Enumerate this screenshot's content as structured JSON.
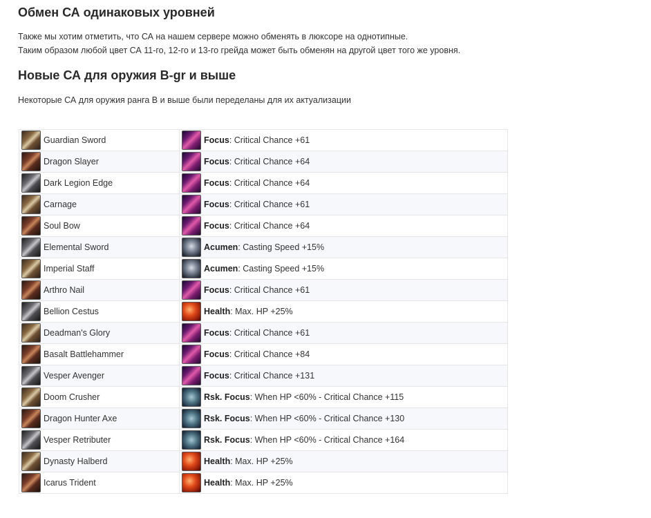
{
  "sections": [
    {
      "heading": "Обмен СА одинаковых уровней",
      "lines": [
        "Также мы хотим отметить, что СА на нашем сервере можно обменять в люксоре на однотипные.",
        "Таким образом любой цвет СА 11-го, 12-го и 13-го грейда может быть обменян на другой цвет того же уровня."
      ]
    },
    {
      "heading": "Новые СА для оружия B-gr и выше",
      "lines": [
        "Некоторые СА для оружия ранга B и выше были переделаны для их актуализации"
      ]
    }
  ],
  "table": {
    "rows": [
      {
        "weapon": "Guardian Sword",
        "weapon_icon": "sword-icon",
        "sa": "Focus",
        "effect": ": Critical Chance +61",
        "sa_icon": "focus-icon"
      },
      {
        "weapon": "Dragon Slayer",
        "weapon_icon": "sword-icon",
        "sa": "Focus",
        "effect": ": Critical Chance +64",
        "sa_icon": "focus-icon"
      },
      {
        "weapon": "Dark Legion Edge",
        "weapon_icon": "sword-icon",
        "sa": "Focus",
        "effect": ": Critical Chance +64",
        "sa_icon": "focus-icon"
      },
      {
        "weapon": "Carnage",
        "weapon_icon": "bow-icon",
        "sa": "Focus",
        "effect": ": Critical Chance +61",
        "sa_icon": "focus-icon"
      },
      {
        "weapon": "Soul Bow",
        "weapon_icon": "bow-icon",
        "sa": "Focus",
        "effect": ": Critical Chance +64",
        "sa_icon": "focus-icon"
      },
      {
        "weapon": "Elemental Sword",
        "weapon_icon": "sword-icon",
        "sa": "Acumen",
        "effect": ": Casting Speed +15%",
        "sa_icon": "acumen-icon"
      },
      {
        "weapon": "Imperial Staff",
        "weapon_icon": "staff-icon",
        "sa": "Acumen",
        "effect": ": Casting Speed +15%",
        "sa_icon": "acumen-icon"
      },
      {
        "weapon": "Arthro Nail",
        "weapon_icon": "fist-icon",
        "sa": "Focus",
        "effect": ": Critical Chance +61",
        "sa_icon": "focus-icon"
      },
      {
        "weapon": "Bellion Cestus",
        "weapon_icon": "fist-icon",
        "sa": "Health",
        "effect": ": Max. HP +25%",
        "sa_icon": "health-icon"
      },
      {
        "weapon": "Deadman's Glory",
        "weapon_icon": "bow-icon",
        "sa": "Focus",
        "effect": ": Critical Chance +61",
        "sa_icon": "focus-icon"
      },
      {
        "weapon": "Basalt Battlehammer",
        "weapon_icon": "hammer-icon",
        "sa": "Focus",
        "effect": ": Critical Chance +84",
        "sa_icon": "focus-icon"
      },
      {
        "weapon": "Vesper Avenger",
        "weapon_icon": "hammer-icon",
        "sa": "Focus",
        "effect": ": Critical Chance +131",
        "sa_icon": "focus-icon"
      },
      {
        "weapon": "Doom Crusher",
        "weapon_icon": "hammer-icon",
        "sa": "Rsk. Focus",
        "effect": ": When HP <60% - Critical Chance +115",
        "sa_icon": "risk-focus-icon"
      },
      {
        "weapon": "Dragon Hunter Axe",
        "weapon_icon": "axe-icon",
        "sa": "Rsk. Focus",
        "effect": ": When HP <60% - Critical Chance +130",
        "sa_icon": "risk-focus-icon"
      },
      {
        "weapon": "Vesper Retributer",
        "weapon_icon": "hammer-icon",
        "sa": "Rsk. Focus",
        "effect": ": When HP <60% - Critical Chance +164",
        "sa_icon": "risk-focus-icon"
      },
      {
        "weapon": "Dynasty Halberd",
        "weapon_icon": "polearm-icon",
        "sa": "Health",
        "effect": ": Max. HP +25%",
        "sa_icon": "health-icon"
      },
      {
        "weapon": "Icarus Trident",
        "weapon_icon": "polearm-icon",
        "sa": "Health",
        "effect": ": Max. HP +25%",
        "sa_icon": "health-icon"
      }
    ]
  }
}
